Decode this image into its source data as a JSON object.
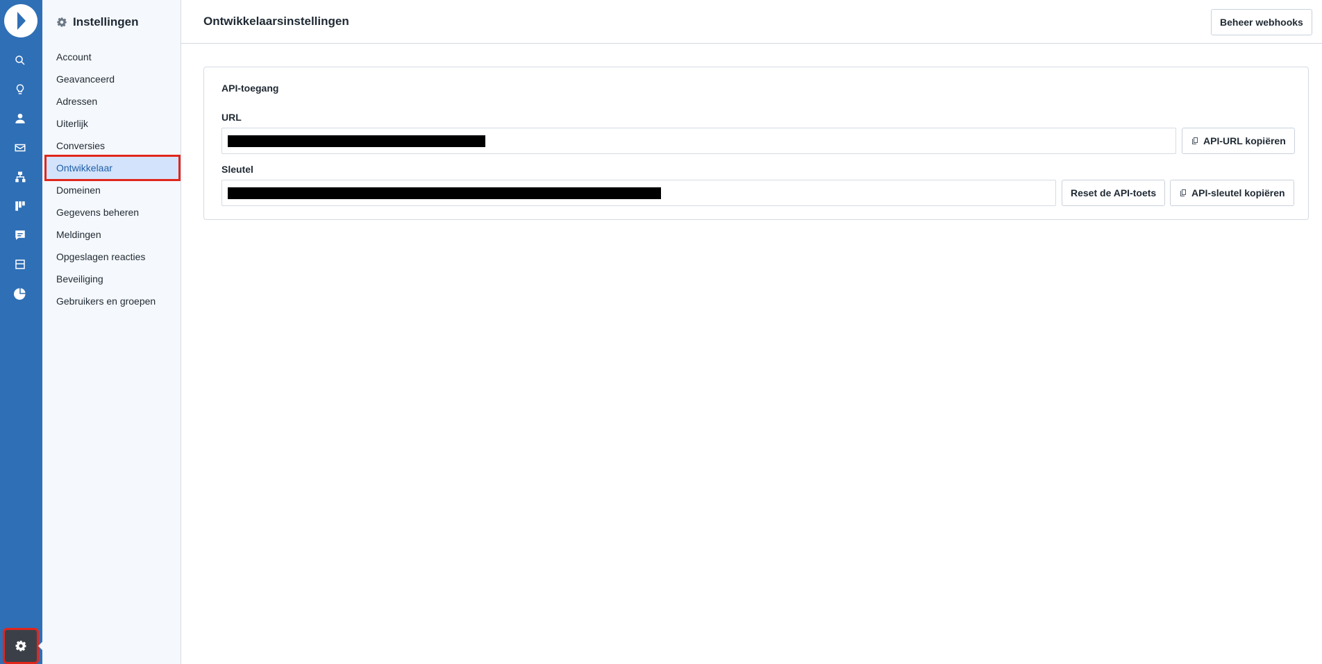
{
  "rail": {
    "icons": [
      "search-icon",
      "lightbulb-icon",
      "person-icon",
      "mail-icon",
      "sitemap-icon",
      "board-icon",
      "chat-icon",
      "inbox-icon",
      "pie-chart-icon"
    ],
    "settings_icon": "gear-icon"
  },
  "sidebar": {
    "title": "Instellingen",
    "items": [
      {
        "label": "Account"
      },
      {
        "label": "Geavanceerd"
      },
      {
        "label": "Adressen"
      },
      {
        "label": "Uiterlijk"
      },
      {
        "label": "Conversies"
      },
      {
        "label": "Ontwikkelaar",
        "active": true
      },
      {
        "label": "Domeinen"
      },
      {
        "label": "Gegevens beheren"
      },
      {
        "label": "Meldingen"
      },
      {
        "label": "Opgeslagen reacties"
      },
      {
        "label": "Beveiliging"
      },
      {
        "label": "Gebruikers en groepen"
      }
    ]
  },
  "header": {
    "title": "Ontwikkelaarsinstellingen",
    "webhooks_button": "Beheer webhooks"
  },
  "api": {
    "section_title": "API-toegang",
    "url_label": "URL",
    "url_value": "",
    "copy_url_button": "API-URL kopiëren",
    "key_label": "Sleutel",
    "key_value": "",
    "reset_button": "Reset de API-toets",
    "copy_key_button": "API-sleutel kopiëren"
  },
  "colors": {
    "rail": "#2f6fb6",
    "sidebar_bg": "#f5f8fc",
    "active_bg": "#d3e3fb",
    "active_text": "#1f5fa8",
    "highlight": "#e1261c"
  }
}
